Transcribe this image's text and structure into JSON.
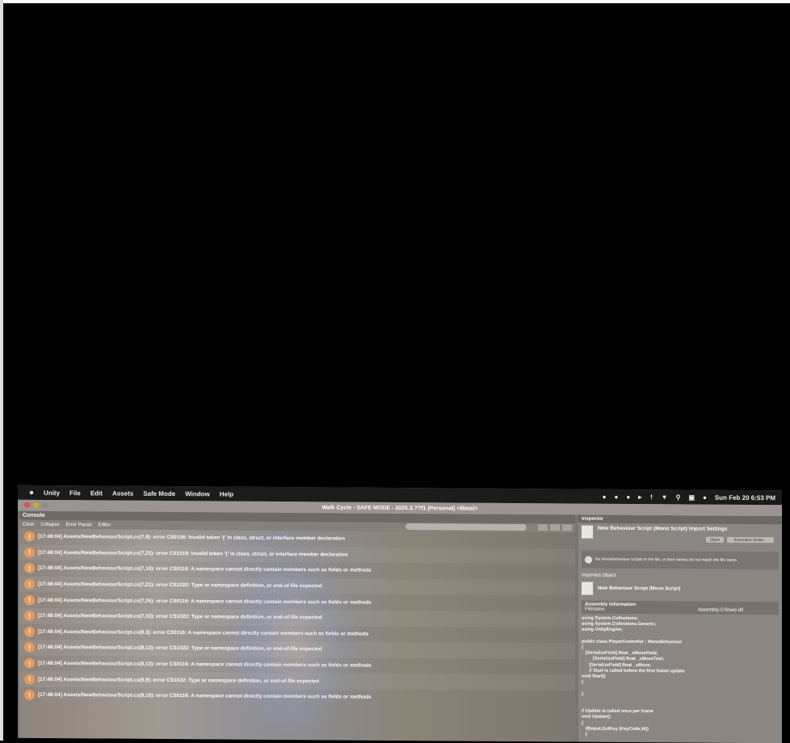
{
  "menubar": {
    "apple": "",
    "items": [
      "Unity",
      "File",
      "Edit",
      "Assets",
      "Safe Mode",
      "Window",
      "Help"
    ],
    "clock": "Sun Feb 20 6:53 PM"
  },
  "window": {
    "title": "Walk Cycle - SAFE MODE - 2020.3.??f1 (Personal) <Metal>"
  },
  "console": {
    "tab": "Console",
    "toolbar": [
      "Clear",
      "Collapse",
      "Error Pause",
      "Editor"
    ],
    "rows": [
      "[17:48:04] Assets/NewBehaviourScript.cs(7,9): error CS0106: Invalid token '{' in class, struct, or interface member declaration",
      "[17:48:04] Assets/NewBehaviourScript.cs(7,23): error CS1519: Invalid token '{' in class, struct, or interface member declaration",
      "[17:48:04] Assets/NewBehaviourScript.cs(7,18): error CS0116: A namespace cannot directly contain members such as fields or methods",
      "[17:48:04] Assets/NewBehaviourScript.cs(7,21): error CS1022: Type or namespace definition, or end-of-file expected",
      "[17:48:04] Assets/NewBehaviourScript.cs(7,25): error CS0116: A namespace cannot directly contain members such as fields or methods",
      "[17:48:04] Assets/NewBehaviourScript.cs(7,33): error CS1022: Type or namespace definition, or end-of-file expected",
      "[17:48:04] Assets/NewBehaviourScript.cs(8,3): error CS0116: A namespace cannot directly contain members such as fields or methods",
      "[17:48:04] Assets/NewBehaviourScript.cs(8,13): error CS1022: Type or namespace definition, or end-of-file expected",
      "[17:48:04] Assets/NewBehaviourScript.cs(8,13): error CS0116: A namespace cannot directly contain members such as fields or methods",
      "[17:48:04] Assets/NewBehaviourScript.cs(9,9): error CS1022: Type or namespace definition, or end-of-file expected",
      "[17:48:04] Assets/NewBehaviourScript.cs(9,10): error CS0116: A namespace cannot directly contain members such as fields or methods"
    ]
  },
  "inspector": {
    "tab": "Inspector",
    "title": "New Behaviour Script (Mono Script) Import Settings",
    "open_label": "Open",
    "execution_order_label": "Execution Order...",
    "info_text": "No MonoBehaviour scripts in the file, or their names do not match the file name.",
    "imported_object_label": "Imported Object",
    "imported_title": "New Behaviour Script (Mono Script)",
    "assembly_header": "Assembly Information",
    "filename_label": "Filename",
    "filename_value": "Assembly-CSharp.dll",
    "code": "using System.Collections;\nusing System.Collections.Generic;\nusing UnityEngine;\n\npublic class PlayerController : MonoBehaviour\n{\n   [SerializeField] float _xMoveField;\n         [SerializeField] float _xMoveTest;\n      [SerializeField] float _xMove;\n      // Start is called before the first frame update\nvoid Start()\n{\n\n}\n\n\n// Update is called once per frame\nvoid Update()\n{\n   if(Input.GetKey (KeyCode.W))\n   {"
  }
}
